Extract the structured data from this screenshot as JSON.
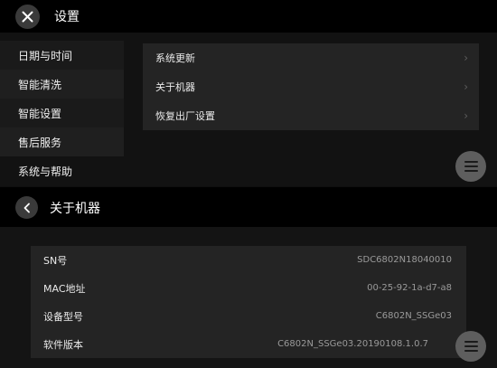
{
  "settings": {
    "title": "设置",
    "sidebar": [
      {
        "label": "日期与时间"
      },
      {
        "label": "智能清洗"
      },
      {
        "label": "智能设置"
      },
      {
        "label": "售后服务"
      },
      {
        "label": "系统与帮助"
      }
    ],
    "menu": [
      {
        "label": "系统更新"
      },
      {
        "label": "关于机器"
      },
      {
        "label": "恢复出厂设置"
      }
    ]
  },
  "about": {
    "title": "关于机器",
    "rows": [
      {
        "key": "SN号",
        "value": "SDC6802N18040010"
      },
      {
        "key": "MAC地址",
        "value": "00-25-92-1a-d7-a8"
      },
      {
        "key": "设备型号",
        "value": "C6802N_SSGe03"
      },
      {
        "key": "软件版本",
        "value": "C6802N_SSGe03.20190108.1.0.7"
      }
    ]
  },
  "icons": {
    "close": "close-icon",
    "back": "chevron-left-icon",
    "menu_fab": "hamburger-icon",
    "chevron": "chevron-right-icon"
  },
  "colors": {
    "background": "#121212",
    "header": "#000000",
    "row": "#242424",
    "fab": "#5e5e5e"
  }
}
